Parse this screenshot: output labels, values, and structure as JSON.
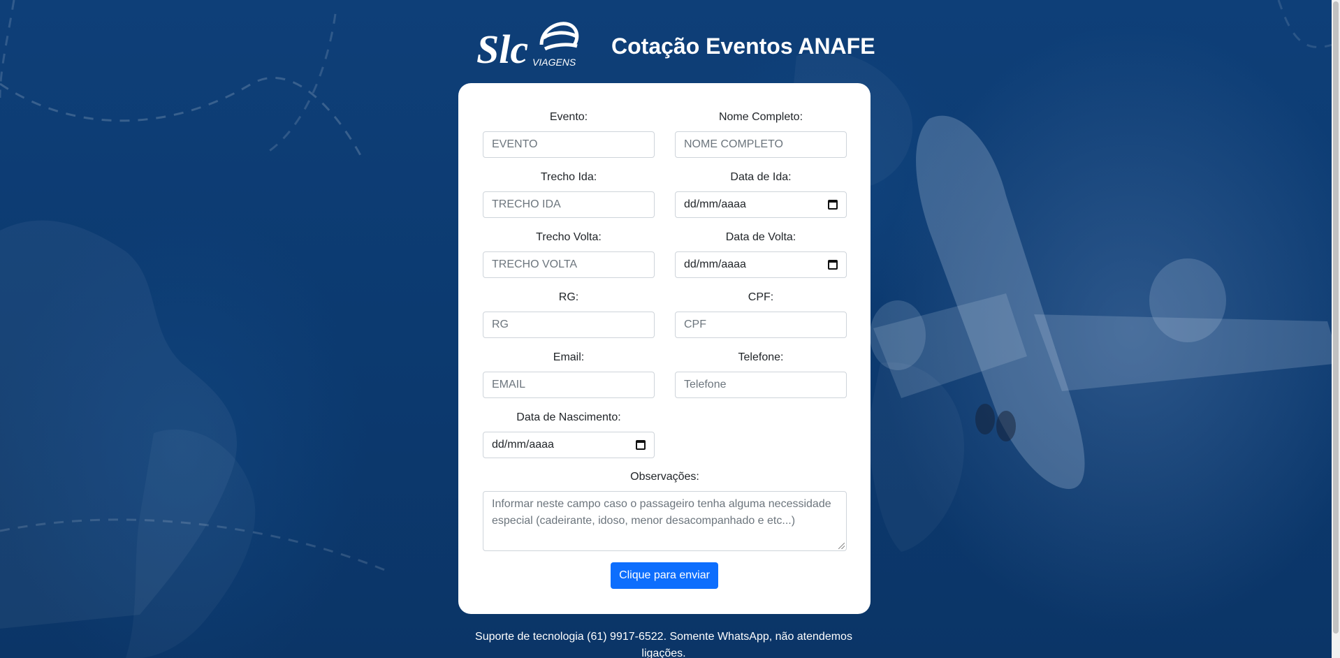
{
  "header": {
    "title": "Cotação Eventos ANAFE",
    "logo_text": "Slc",
    "logo_sub": "VIAGENS"
  },
  "form": {
    "fields": [
      {
        "label": "Evento:",
        "placeholder": "EVENTO",
        "type": "text"
      },
      {
        "label": "Nome Completo:",
        "placeholder": "NOME COMPLETO",
        "type": "text"
      },
      {
        "label": "Trecho Ida:",
        "placeholder": "TRECHO IDA",
        "type": "text"
      },
      {
        "label": "Data de Ida:",
        "placeholder": "dd/mm/aaaa",
        "type": "date"
      },
      {
        "label": "Trecho Volta:",
        "placeholder": "TRECHO VOLTA",
        "type": "text"
      },
      {
        "label": "Data de Volta:",
        "placeholder": "dd/mm/aaaa",
        "type": "date"
      },
      {
        "label": "RG:",
        "placeholder": "RG",
        "type": "text"
      },
      {
        "label": "CPF:",
        "placeholder": "CPF",
        "type": "text"
      },
      {
        "label": "Email:",
        "placeholder": "EMAIL",
        "type": "text"
      },
      {
        "label": "Telefone:",
        "placeholder": "Telefone",
        "type": "text"
      },
      {
        "label": "Data de Nascimento:",
        "placeholder": "dd/mm/aaaa",
        "type": "date"
      }
    ],
    "observations": {
      "label": "Observações:",
      "placeholder": "Informar neste campo caso o passageiro tenha alguma necessidade especial (cadeirante, idoso, menor desacompanhado e etc...)"
    },
    "submit_label": "Clique para enviar"
  },
  "footer": {
    "support_text": "Suporte de tecnologia (61) 9917-6522. Somente WhatsApp, não atendemos ligações."
  },
  "colors": {
    "background": "#0d3a6e",
    "card": "#ffffff",
    "button": "#0d6efd"
  }
}
